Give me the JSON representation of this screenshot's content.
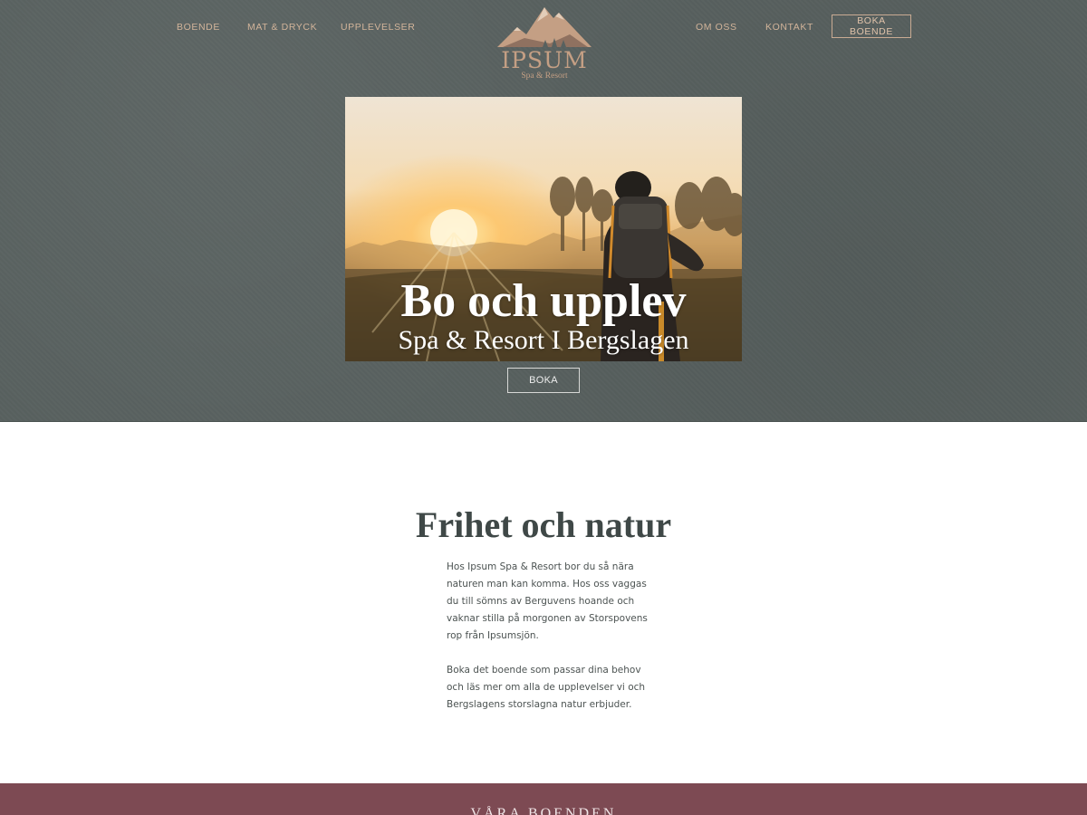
{
  "nav": {
    "left": [
      {
        "label": "BOENDE"
      },
      {
        "label": "MAT & DRYCK"
      },
      {
        "label": "UPPLEVELSER"
      }
    ],
    "right": [
      {
        "label": "OM OSS"
      },
      {
        "label": "KONTAKT"
      }
    ],
    "cta_label": "BOKA BOENDE"
  },
  "logo": {
    "name": "IPSUM",
    "tagline": "Spa & Resort",
    "icon": "mountain-icon"
  },
  "hero": {
    "title": "Bo och upplev",
    "subtitle": "Spa & Resort I Bergslagen",
    "button_label": "BOKA",
    "image": "hiker-sunrise-photo"
  },
  "intro": {
    "heading": "Frihet och natur",
    "paragraphs": [
      "Hos Ipsum Spa & Resort bor du så nära naturen man kan komma. Hos oss vaggas du till sömns av Berguvens hoande och vaknar stilla på morgonen av Storspovens rop från Ipsumsjön.",
      "Boka det boende som passar dina behov och läs mer om alla de upplevelser vi och Bergslagens storslagna natur erbjuder."
    ]
  },
  "section": {
    "title": "VÅRA BOENDEN"
  },
  "colors": {
    "hero_bg": "#58615f",
    "accent": "#c49f84",
    "heading": "#3f4847",
    "band": "#7d4a53"
  }
}
